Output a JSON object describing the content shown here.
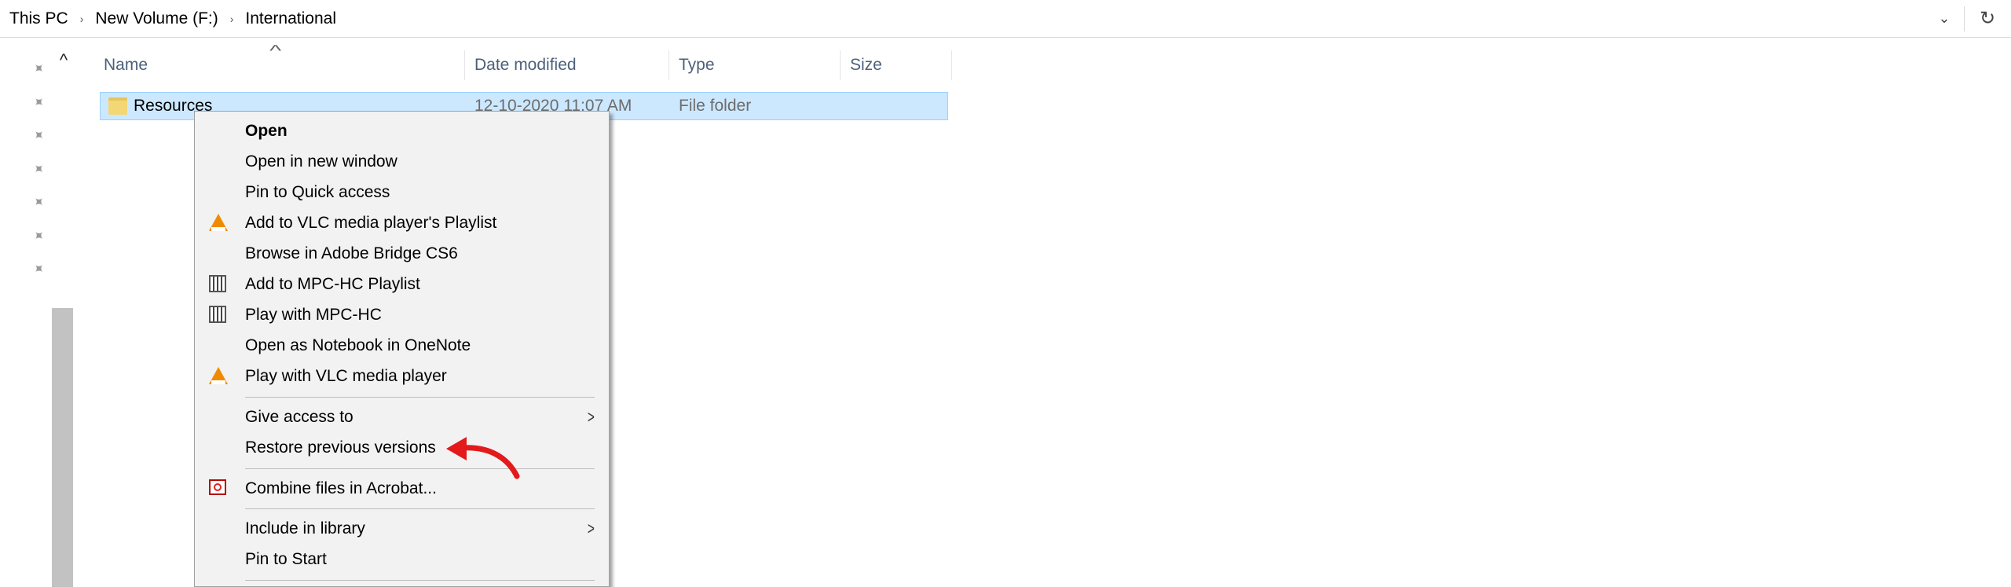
{
  "address_bar": {
    "crumbs": [
      "This PC",
      "New Volume (F:)",
      "International"
    ],
    "separator": "›",
    "dropdown_glyph": "⌄",
    "refresh_glyph": "↻"
  },
  "columns": {
    "name": "Name",
    "date_modified": "Date modified",
    "type": "Type",
    "size": "Size"
  },
  "file_row": {
    "name": "Resources",
    "date_modified": "12-10-2020 11:07 AM",
    "type": "File folder",
    "size": ""
  },
  "context_menu": {
    "items": [
      {
        "label": "Open",
        "bold": true
      },
      {
        "label": "Open in new window"
      },
      {
        "label": "Pin to Quick access"
      },
      {
        "label": "Add to VLC media player's Playlist",
        "icon": "vlc-icon"
      },
      {
        "label": "Browse in Adobe Bridge CS6"
      },
      {
        "label": "Add to MPC-HC Playlist",
        "icon": "mpc-hc-icon"
      },
      {
        "label": "Play with MPC-HC",
        "icon": "mpc-hc-icon"
      },
      {
        "label": "Open as Notebook in OneNote"
      },
      {
        "label": "Play with VLC media player",
        "icon": "vlc-icon"
      },
      {
        "label": "Give access to",
        "submenu": true
      },
      {
        "label": "Restore previous versions",
        "highlighted_by_arrow": true
      },
      {
        "label": "Combine files in Acrobat...",
        "icon": "acrobat-icon"
      },
      {
        "label": "Include in library",
        "submenu": true
      },
      {
        "label": "Pin to Start"
      }
    ],
    "submenu_glyph": ">"
  },
  "colors": {
    "selection_bg": "#cce8ff",
    "selection_border": "#99d1ff",
    "menu_bg": "#f2f2f2",
    "annotation_arrow": "#e3191b",
    "header_text": "#4c607a"
  }
}
